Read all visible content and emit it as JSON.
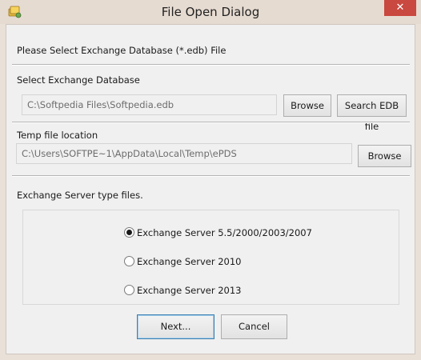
{
  "window": {
    "title": "File Open Dialog",
    "close_glyph": "✕",
    "app_icon": "app-icon"
  },
  "header": {
    "instruction": "Please Select Exchange Database (*.edb) File"
  },
  "database": {
    "section_label": "Select Exchange Database",
    "path_value": "C:\\Softpedia Files\\Softpedia.edb",
    "browse_label": "Browse",
    "search_label": "Search EDB file"
  },
  "temp": {
    "section_label": "Temp file location",
    "path_value": "C:\\Users\\SOFTPE~1\\AppData\\Local\\Temp\\ePDS",
    "browse_label": "Browse"
  },
  "server_type": {
    "section_label": "Exchange Server type files.",
    "options": [
      {
        "label": "Exchange Server 5.5/2000/2003/2007",
        "checked": true
      },
      {
        "label": "Exchange Server 2010",
        "checked": false
      },
      {
        "label": "Exchange Server 2013",
        "checked": false
      }
    ]
  },
  "footer": {
    "next_label": "Next...",
    "cancel_label": "Cancel"
  }
}
